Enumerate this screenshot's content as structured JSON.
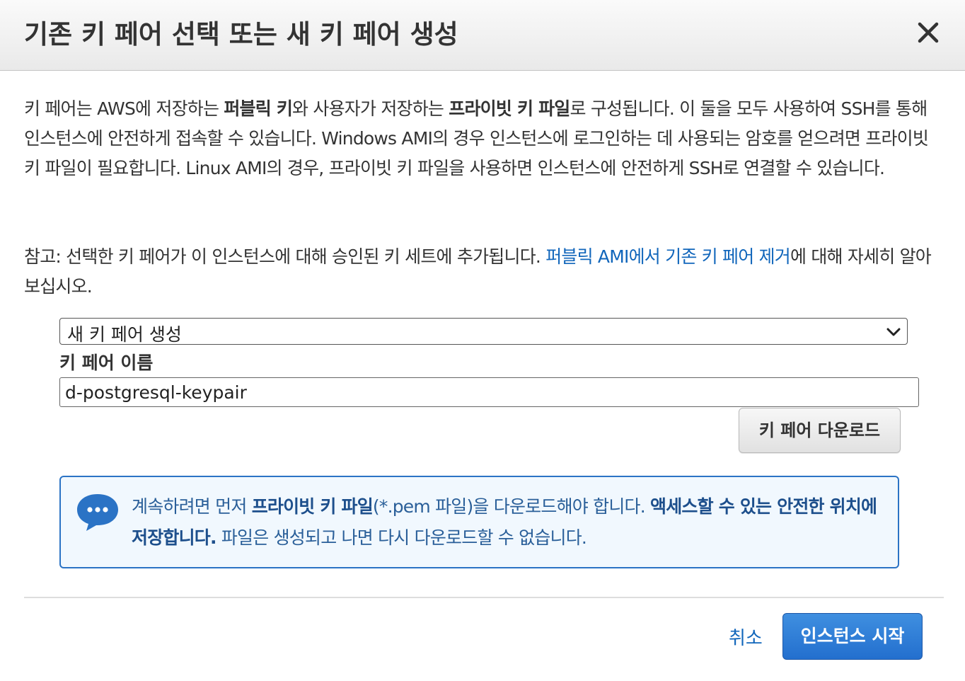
{
  "dialog": {
    "title": "기존 키 페어 선택 또는 새 키 페어 생성",
    "close_label": "×"
  },
  "intro": {
    "p1_a": "키 페어는 AWS에 저장하는 ",
    "p1_b": "퍼블릭 키",
    "p1_c": "와 사용자가 저장하는 ",
    "p1_d": "프라이빗 키 파일",
    "p1_e": "로 구성됩니다. 이 둘을 모두 사용하여 SSH를 통해 인스턴스에 안전하게 접속할 수 있습니다. Windows AMI의 경우 인스턴스에 로그인하는 데 사용되는 암호를 얻으려면 프라이빗 키 파일이 필요합니다. Linux AMI의 경우, 프라이빗 키 파일을 사용하면 인스턴스에 안전하게 SSH로 연결할 수 있습니다."
  },
  "note": {
    "text_a": "참고: 선택한 키 페어가 이 인스턴스에 대해 승인된 키 세트에 추가됩니다. ",
    "link": "퍼블릭 AMI에서 기존 키 페어 제거",
    "text_b": "에 대해 자세히 알아보십시오."
  },
  "key_pair_select": {
    "selected": "새 키 페어 생성"
  },
  "key_pair_name": {
    "label": "키 페어 이름",
    "value": "d-postgresql-keypair"
  },
  "download_button": "키 페어 다운로드",
  "info": {
    "a": "계속하려면 먼저 ",
    "b": "프라이빗 키 파일",
    "c": "(*.pem 파일)을 다운로드해야 합니다. ",
    "d": "액세스할 수 있는 안전한 위치에 저장합니다.",
    "e": " 파일은 생성되고 나면 다시 다운로드할 수 없습니다."
  },
  "footer": {
    "cancel": "취소",
    "launch": "인스턴스 시작"
  },
  "colors": {
    "link": "#1166bb",
    "primary_button": "#2f7fd6",
    "info_border": "#2b73c5",
    "info_background": "#f1f8fe"
  },
  "icons": {
    "close": "close-icon",
    "chevron": "chevron-down-icon",
    "info": "chat-bubble-icon"
  }
}
